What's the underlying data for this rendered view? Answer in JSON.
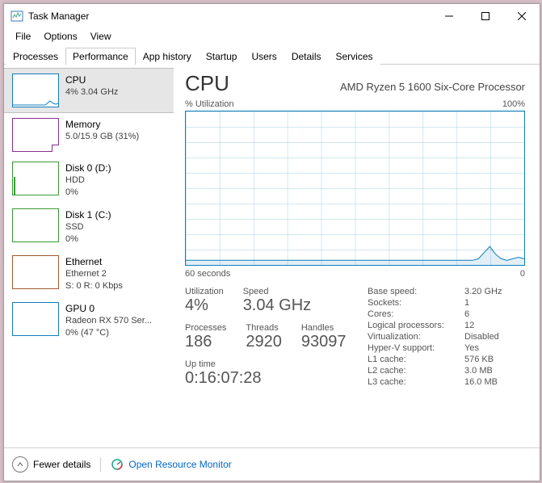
{
  "window": {
    "title": "Task Manager"
  },
  "menus": {
    "file": "File",
    "options": "Options",
    "view": "View"
  },
  "tabs": {
    "processes": "Processes",
    "performance": "Performance",
    "app_history": "App history",
    "startup": "Startup",
    "users": "Users",
    "details": "Details",
    "services": "Services"
  },
  "sidebar": {
    "cpu": {
      "name": "CPU",
      "sub1": "4% 3.04 GHz",
      "color": "#117dbb"
    },
    "memory": {
      "name": "Memory",
      "sub1": "5.0/15.9 GB (31%)",
      "color": "#8b2e8b"
    },
    "disk0": {
      "name": "Disk 0 (D:)",
      "sub1": "HDD",
      "sub2": "0%",
      "color": "#3a9b35"
    },
    "disk1": {
      "name": "Disk 1 (C:)",
      "sub1": "SSD",
      "sub2": "0%",
      "color": "#3a9b35"
    },
    "ethernet": {
      "name": "Ethernet",
      "sub1": "Ethernet 2",
      "sub2": "S: 0 R: 0 Kbps",
      "color": "#a05a2c"
    },
    "gpu": {
      "name": "GPU 0",
      "sub1": "Radeon RX 570 Ser...",
      "sub2": "0% (47 °C)",
      "color": "#117dbb"
    }
  },
  "main": {
    "title": "CPU",
    "model": "AMD Ryzen 5 1600 Six-Core Processor",
    "chart_label_left": "% Utilization",
    "chart_label_right": "100%",
    "axis_left": "60 seconds",
    "axis_right": "0",
    "util_lbl": "Utilization",
    "util_val": "4%",
    "speed_lbl": "Speed",
    "speed_val": "3.04 GHz",
    "proc_lbl": "Processes",
    "proc_val": "186",
    "threads_lbl": "Threads",
    "threads_val": "2920",
    "handles_lbl": "Handles",
    "handles_val": "93097",
    "uptime_lbl": "Up time",
    "uptime_val": "0:16:07:28",
    "right": {
      "base_speed_k": "Base speed:",
      "base_speed_v": "3.20 GHz",
      "sockets_k": "Sockets:",
      "sockets_v": "1",
      "cores_k": "Cores:",
      "cores_v": "6",
      "log_k": "Logical processors:",
      "log_v": "12",
      "virt_k": "Virtualization:",
      "virt_v": "Disabled",
      "hyperv_k": "Hyper-V support:",
      "hyperv_v": "Yes",
      "l1_k": "L1 cache:",
      "l1_v": "576 KB",
      "l2_k": "L2 cache:",
      "l2_v": "3.0 MB",
      "l3_k": "L3 cache:",
      "l3_v": "16.0 MB"
    }
  },
  "footer": {
    "fewer": "Fewer details",
    "resmon": "Open Resource Monitor"
  },
  "chart_data": {
    "type": "line",
    "title": "% Utilization",
    "ylabel": "% Utilization",
    "ylim": [
      0,
      100
    ],
    "xlim_seconds": [
      60,
      0
    ],
    "series": [
      {
        "name": "CPU",
        "values": [
          3,
          3,
          3,
          3,
          3,
          3,
          3,
          3,
          3,
          3,
          3,
          3,
          3,
          3,
          3,
          3,
          3,
          3,
          3,
          3,
          3,
          3,
          3,
          3,
          3,
          3,
          3,
          3,
          3,
          3,
          3,
          3,
          3,
          3,
          3,
          3,
          3,
          3,
          3,
          3,
          3,
          3,
          3,
          3,
          3,
          3,
          3,
          3,
          3,
          3,
          3,
          4,
          8,
          12,
          7,
          4,
          3,
          4,
          5,
          4
        ]
      }
    ]
  }
}
